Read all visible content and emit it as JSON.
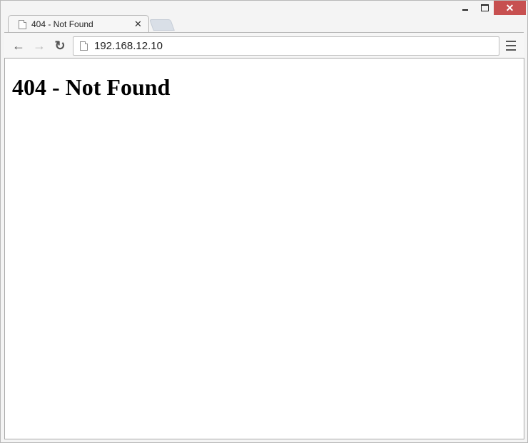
{
  "window": {
    "controls": {
      "minimize": "minimize",
      "maximize": "maximize",
      "close": "✕"
    }
  },
  "tabs": [
    {
      "title": "404 - Not Found",
      "icon": "document-icon",
      "close": "✕",
      "active": true
    }
  ],
  "toolbar": {
    "back": "←",
    "forward": "→",
    "reload": "↻",
    "url": "192.168.12.10"
  },
  "page": {
    "heading": "404 - Not Found"
  }
}
